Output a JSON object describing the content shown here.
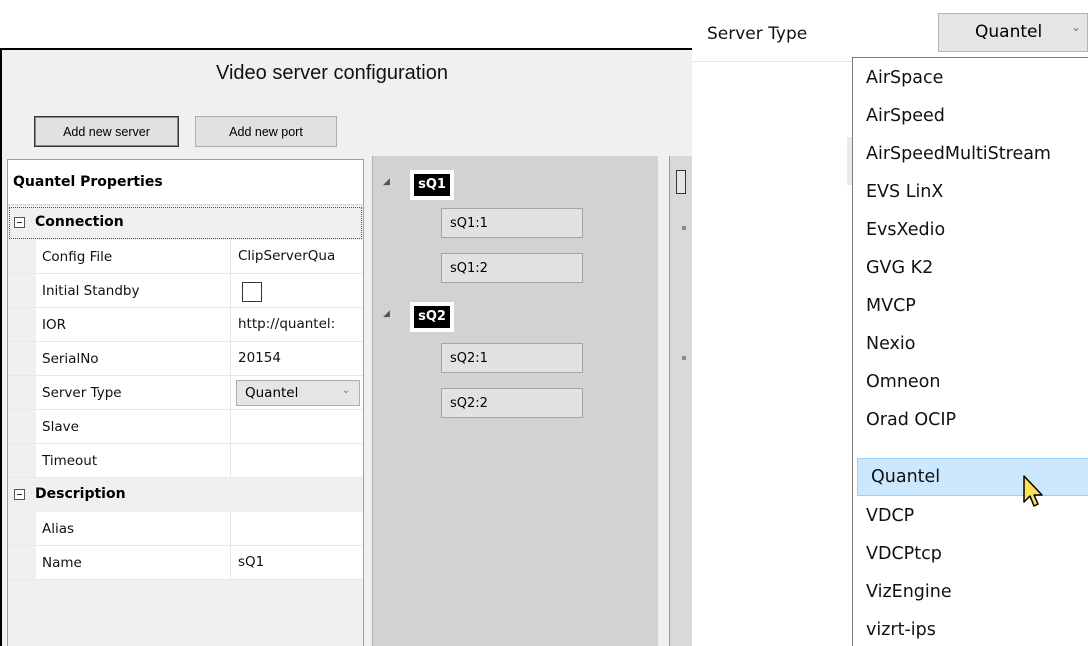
{
  "window": {
    "title": "Video server configuration",
    "buttons": {
      "add_server": "Add new server",
      "add_port": "Add new port"
    }
  },
  "property_grid": {
    "header": "Quantel Properties",
    "connection": {
      "title": "Connection",
      "config_file": {
        "key": "Config File",
        "value": "ClipServerQua"
      },
      "initial_standby": {
        "key": "Initial Standby",
        "checked": false
      },
      "ior": {
        "key": "IOR",
        "value": "http://quantel:"
      },
      "serial_no": {
        "key": "SerialNo",
        "value": "20154"
      },
      "server_type": {
        "key": "Server Type",
        "value": "Quantel"
      },
      "slave": {
        "key": "Slave",
        "value": ""
      },
      "timeout": {
        "key": "Timeout",
        "value": ""
      }
    },
    "description": {
      "title": "Description",
      "alias": {
        "key": "Alias",
        "value": ""
      },
      "name": {
        "key": "Name",
        "value": "sQ1"
      }
    }
  },
  "tree": {
    "servers": [
      {
        "name": "sQ1",
        "ports": [
          "sQ1:1",
          "sQ1:2"
        ]
      },
      {
        "name": "sQ2",
        "ports": [
          "sQ2:1",
          "sQ2:2"
        ]
      }
    ]
  },
  "zoom_panel": {
    "label": "Server Type",
    "value": "Quantel",
    "options": [
      "AirSpace",
      "AirSpeed",
      "AirSpeedMultiStream",
      "EVS LinX",
      "EvsXedio",
      "GVG K2",
      "MVCP",
      "Nexio",
      "Omneon",
      "Orad OCIP",
      "Quantel",
      "VDCP",
      "VDCPtcp",
      "VizEngine",
      "vizrt-ips"
    ],
    "highlighted": "Quantel"
  },
  "colors": {
    "highlight": "#cce8ff",
    "highlight_border": "#99d1ff",
    "tree_bg": "#d2d2d2"
  },
  "icons": [
    "collapse-box-icon",
    "expand-triangle-icon",
    "dropdown-arrow-icon",
    "mouse-pointer-icon"
  ]
}
